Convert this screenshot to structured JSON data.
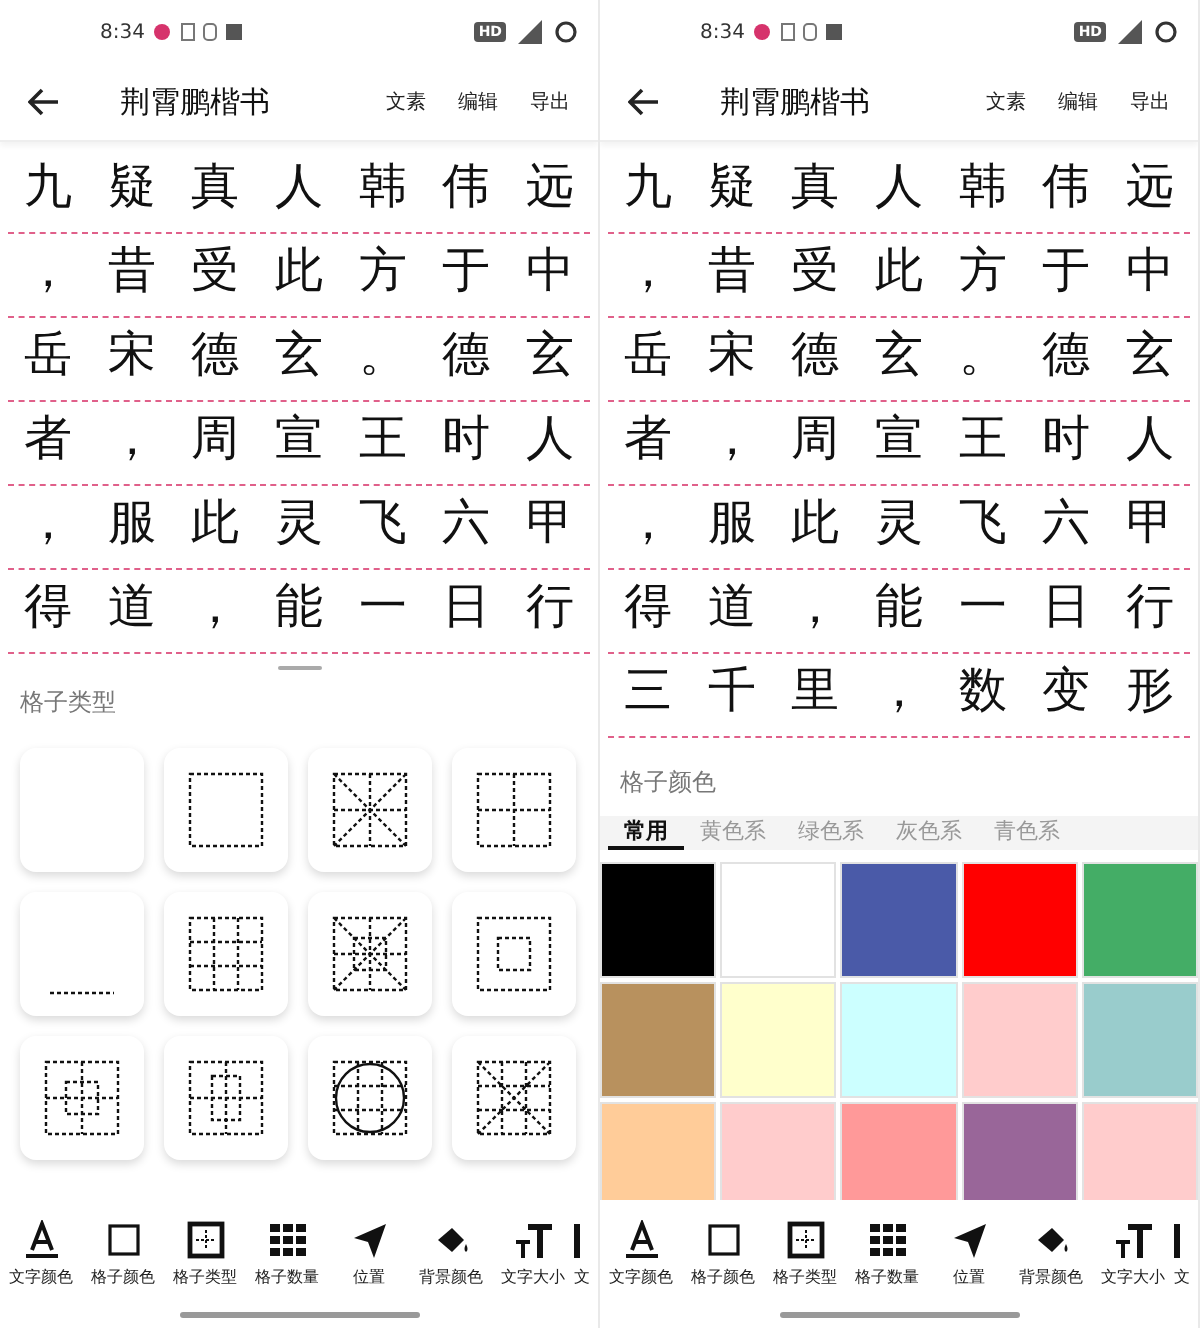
{
  "screens": [
    {
      "status_bar": {
        "time": "8:34",
        "badge": "HD"
      },
      "app_bar": {
        "title": "荆霄鹏楷书",
        "actions": [
          "文素",
          "编辑",
          "导出"
        ]
      },
      "text_grid": {
        "rows": [
          [
            "九",
            "疑",
            "真",
            "人",
            "韩",
            "伟",
            "远"
          ],
          [
            "，",
            "昔",
            "受",
            "此",
            "方",
            "于",
            "中"
          ],
          [
            "岳",
            "宋",
            "德",
            "玄",
            "。",
            "德",
            "玄"
          ],
          [
            "者",
            "，",
            "周",
            "宣",
            "王",
            "时",
            "人"
          ],
          [
            "，",
            "服",
            "此",
            "灵",
            "飞",
            "六",
            "甲"
          ],
          [
            "得",
            "道",
            "，",
            "能",
            "一",
            "日",
            "行"
          ]
        ]
      },
      "sheet": {
        "kind": "grid_types",
        "title": "格子类型",
        "tiles": [
          {
            "kind": "blank"
          },
          {
            "kind": "square"
          },
          {
            "kind": "mi"
          },
          {
            "kind": "tian"
          },
          {
            "kind": "line"
          },
          {
            "kind": "jiu"
          },
          {
            "kind": "mi_inner"
          },
          {
            "kind": "hui"
          },
          {
            "kind": "tian_square"
          },
          {
            "kind": "tian_rect"
          },
          {
            "kind": "circle"
          },
          {
            "kind": "mi_jiu"
          }
        ]
      },
      "toolbar": [
        {
          "kind": "text_color",
          "label": "文字颜色"
        },
        {
          "kind": "grid_color",
          "label": "格子颜色"
        },
        {
          "kind": "grid_type",
          "label": "格子类型"
        },
        {
          "kind": "grid_count",
          "label": "格子数量"
        },
        {
          "kind": "position",
          "label": "位置"
        },
        {
          "kind": "bg_color",
          "label": "背景颜色"
        },
        {
          "kind": "text_size",
          "label": "文字大小"
        },
        {
          "kind": "partial",
          "label": "文"
        }
      ]
    },
    {
      "status_bar": {
        "time": "8:34",
        "badge": "HD"
      },
      "app_bar": {
        "title": "荆霄鹏楷书",
        "actions": [
          "文素",
          "编辑",
          "导出"
        ]
      },
      "text_grid": {
        "rows": [
          [
            "九",
            "疑",
            "真",
            "人",
            "韩",
            "伟",
            "远"
          ],
          [
            "，",
            "昔",
            "受",
            "此",
            "方",
            "于",
            "中"
          ],
          [
            "岳",
            "宋",
            "德",
            "玄",
            "。",
            "德",
            "玄"
          ],
          [
            "者",
            "，",
            "周",
            "宣",
            "王",
            "时",
            "人"
          ],
          [
            "，",
            "服",
            "此",
            "灵",
            "飞",
            "六",
            "甲"
          ],
          [
            "得",
            "道",
            "，",
            "能",
            "一",
            "日",
            "行"
          ],
          [
            "三",
            "千",
            "里",
            "，",
            "数",
            "变",
            "形"
          ]
        ]
      },
      "sheet": {
        "kind": "grid_colors",
        "title": "格子颜色",
        "tabs": [
          {
            "label": "常用",
            "selected": true
          },
          {
            "label": "黄色系",
            "selected": false
          },
          {
            "label": "绿色系",
            "selected": false
          },
          {
            "label": "灰色系",
            "selected": false
          },
          {
            "label": "青色系",
            "selected": false
          }
        ],
        "swatches": [
          {
            "color": "#000000"
          },
          {
            "color": "#ffffff"
          },
          {
            "color": "#4a5aa8"
          },
          {
            "color": "#ff0000"
          },
          {
            "color": "#44ad66"
          },
          {
            "color": "#b8915e"
          },
          {
            "color": "#ffffcc"
          },
          {
            "color": "#ccffff"
          },
          {
            "color": "#ffcccc"
          },
          {
            "color": "#99cccc"
          },
          {
            "color": "#ffcc99"
          },
          {
            "color": "#ffcccc"
          },
          {
            "color": "#ff9999"
          },
          {
            "color": "#996699"
          },
          {
            "color": "#ffcccc"
          }
        ]
      },
      "toolbar": [
        {
          "kind": "text_color",
          "label": "文字颜色"
        },
        {
          "kind": "grid_color",
          "label": "格子颜色"
        },
        {
          "kind": "grid_type",
          "label": "格子类型"
        },
        {
          "kind": "grid_count",
          "label": "格子数量"
        },
        {
          "kind": "position",
          "label": "位置"
        },
        {
          "kind": "bg_color",
          "label": "背景颜色"
        },
        {
          "kind": "text_size",
          "label": "文字大小"
        },
        {
          "kind": "partial",
          "label": "文"
        }
      ]
    }
  ]
}
